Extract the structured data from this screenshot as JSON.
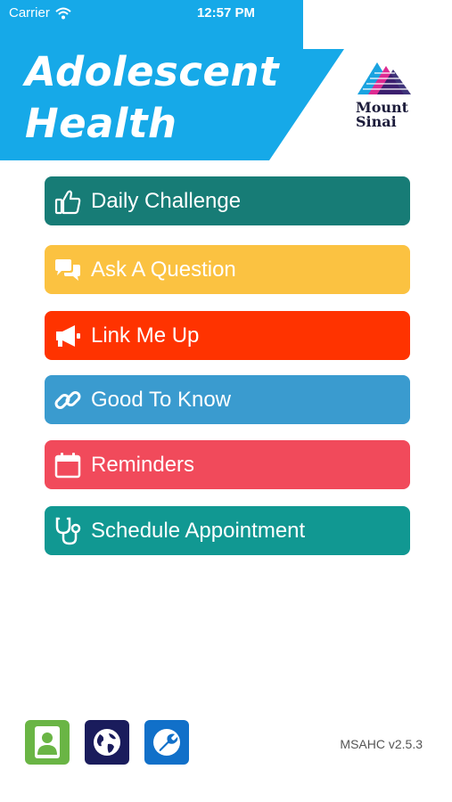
{
  "status_bar": {
    "carrier": "Carrier",
    "time": "12:57 PM"
  },
  "header": {
    "title_line1": "Adolescent",
    "title_line2": "Health",
    "logo_line1": "Mount",
    "logo_line2": "Sinai",
    "banner_color": "#16a9e8"
  },
  "menu": [
    {
      "label": "Daily Challenge",
      "icon": "thumbs-up-icon",
      "color": "#177c76"
    },
    {
      "label": "Ask A Question",
      "icon": "chat-bubbles-icon",
      "color": "#fbc241"
    },
    {
      "label": "Link Me Up",
      "icon": "megaphone-icon",
      "color": "#ff3300"
    },
    {
      "label": "Good To Know",
      "icon": "link-icon",
      "color": "#3a9bcf"
    },
    {
      "label": "Reminders",
      "icon": "calendar-icon",
      "color": "#f14a5b"
    },
    {
      "label": "Schedule Appointment",
      "icon": "stethoscope-icon",
      "color": "#119892"
    }
  ],
  "bottom": {
    "buttons": [
      {
        "icon": "contact-icon",
        "color": "#6ab545"
      },
      {
        "icon": "globe-icon",
        "color": "#1a1c5c"
      },
      {
        "icon": "wrench-icon",
        "color": "#1170c9"
      }
    ],
    "version": "MSAHC v2.5.3"
  }
}
